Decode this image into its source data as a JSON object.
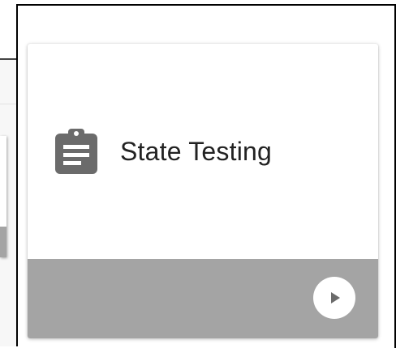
{
  "card": {
    "title": "State Testing",
    "icon": "clipboard-icon",
    "action_icon": "play-icon"
  },
  "colors": {
    "footer": "#a4a4a4",
    "icon": "#6b6b6b",
    "title_text": "#222222"
  }
}
